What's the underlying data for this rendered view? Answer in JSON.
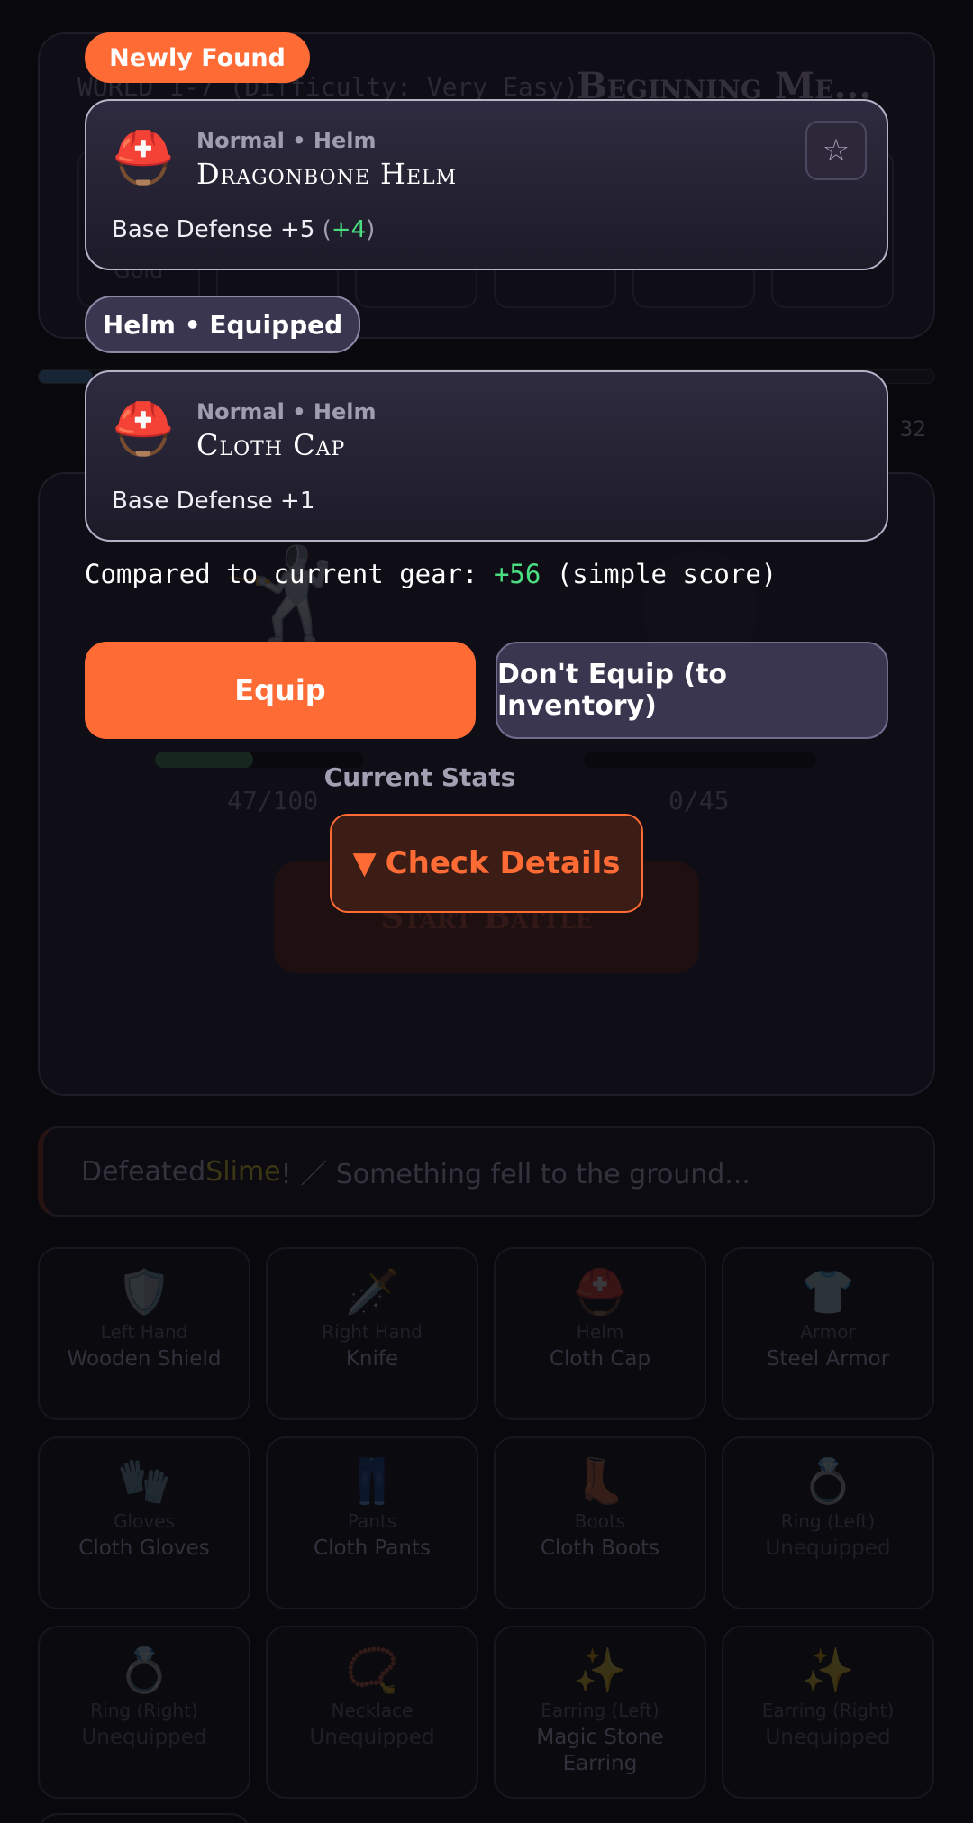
{
  "background": {
    "world_text": "WORLD 1-7 (Difficulty: Very Easy)",
    "stage_title": "Beginning Me...",
    "gold_label": "Gold",
    "stage_progress_fraction": 0.06,
    "progress_count": "/ 32",
    "player_hp": {
      "text": "47/100",
      "fraction": 0.47
    },
    "enemy_hp": {
      "text": "0/45",
      "fraction": 0
    },
    "start_battle": "Start Battle",
    "log": {
      "prefix": "Defeated ",
      "enemy": "Slime",
      "suffix": "! ／ Something fell to the ground..."
    },
    "gear": [
      {
        "icon": "🛡️",
        "icon_name": "shield-icon",
        "slot": "Left Hand",
        "item": "Wooden Shield"
      },
      {
        "icon": "🗡️",
        "icon_name": "dagger-icon",
        "slot": "Right Hand",
        "item": "Knife"
      },
      {
        "icon": "⛑️",
        "icon_name": "helmet-icon",
        "slot": "Helm",
        "item": "Cloth Cap"
      },
      {
        "icon": "👕",
        "icon_name": "shirt-icon",
        "slot": "Armor",
        "item": "Steel Armor"
      },
      {
        "icon": "🧤",
        "icon_name": "gloves-icon",
        "slot": "Gloves",
        "item": "Cloth Gloves"
      },
      {
        "icon": "👖",
        "icon_name": "pants-icon",
        "slot": "Pants",
        "item": "Cloth Pants"
      },
      {
        "icon": "👢",
        "icon_name": "boot-icon",
        "slot": "Boots",
        "item": "Cloth Boots"
      },
      {
        "icon": "💍",
        "icon_name": "ring-icon",
        "slot": "Ring (Left)",
        "item": "Unequipped"
      },
      {
        "icon": "💍",
        "icon_name": "ring-icon",
        "slot": "Ring (Right)",
        "item": "Unequipped"
      },
      {
        "icon": "📿",
        "icon_name": "necklace-icon",
        "slot": "Necklace",
        "item": "Unequipped"
      },
      {
        "icon": "✨",
        "icon_name": "sparkles-icon",
        "slot": "Earring (Left)",
        "item": "Magic Stone Earring"
      },
      {
        "icon": "✨",
        "icon_name": "sparkles-icon",
        "slot": "Earring (Right)",
        "item": "Unequipped"
      }
    ]
  },
  "modal": {
    "new_badge": "Newly Found",
    "new_item": {
      "icon": "⛑️",
      "meta": "Normal • Helm",
      "name": "Dragonbone Helm",
      "defense_prefix": "Base Defense +5 ",
      "defense_open": "(",
      "defense_delta": "+4",
      "defense_close": ")",
      "star": "☆"
    },
    "equipped_badge": "Helm • Equipped",
    "current_item": {
      "icon": "⛑️",
      "meta": "Normal • Helm",
      "name": "Cloth Cap",
      "defense": "Base Defense +1"
    },
    "compare_prefix": "Compared to current gear: ",
    "compare_delta": "+56",
    "compare_suffix": " (simple score)",
    "equip_label": "Equip",
    "noequip_label": "Don't Equip (to Inventory)",
    "current_stats_label": "Current Stats",
    "details_arrow": "▼",
    "details_label": "Check Details",
    "colors": {
      "accent": "#ff6b35",
      "positive": "#4ade80",
      "card": "#2f2b40"
    }
  }
}
